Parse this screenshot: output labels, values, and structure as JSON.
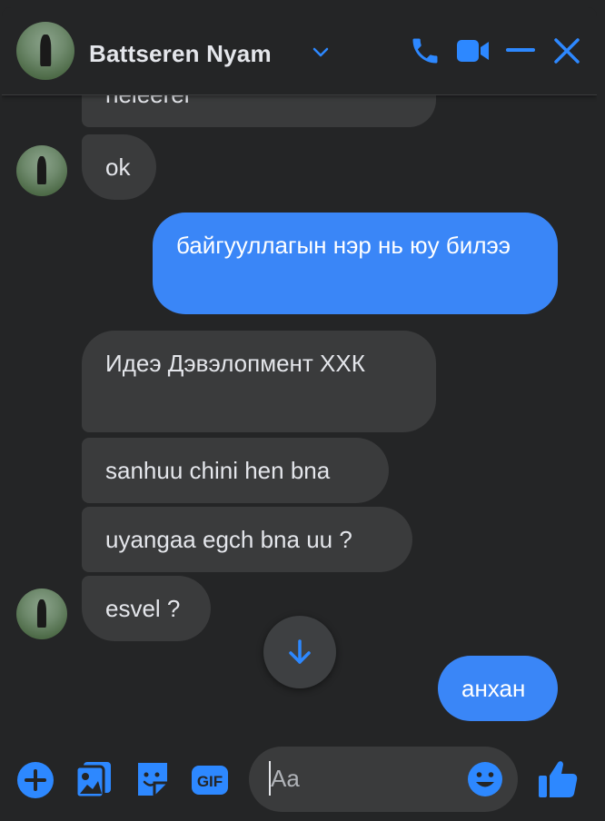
{
  "header": {
    "contact_name": "Battseren Nyam",
    "icons": [
      "chevron-down-icon",
      "phone-icon",
      "video-icon",
      "minimize-icon",
      "close-icon"
    ]
  },
  "messages": [
    {
      "direction": "in",
      "text": "neleerei"
    },
    {
      "direction": "in",
      "text": "ok"
    },
    {
      "direction": "out",
      "text": "байгууллагын нэр нь юу билээ"
    },
    {
      "direction": "in",
      "text": "Идеэ Дэвэлопмент ХХК"
    },
    {
      "direction": "in",
      "text": "sanhuu chini hen bna"
    },
    {
      "direction": "in",
      "text": "uyangaa egch bna uu ?"
    },
    {
      "direction": "in",
      "text": "esvel ?"
    },
    {
      "direction": "out",
      "text": "анхан"
    }
  ],
  "composer": {
    "placeholder": "Aa",
    "icons": [
      "plus-icon",
      "photo-icon",
      "sticker-icon",
      "gif-icon",
      "emoji-icon",
      "like-icon"
    ]
  },
  "colors": {
    "background": "#242526",
    "incoming_bubble": "#3a3b3c",
    "outgoing_bubble": "#3a86f7",
    "accent": "#2d88ff"
  }
}
